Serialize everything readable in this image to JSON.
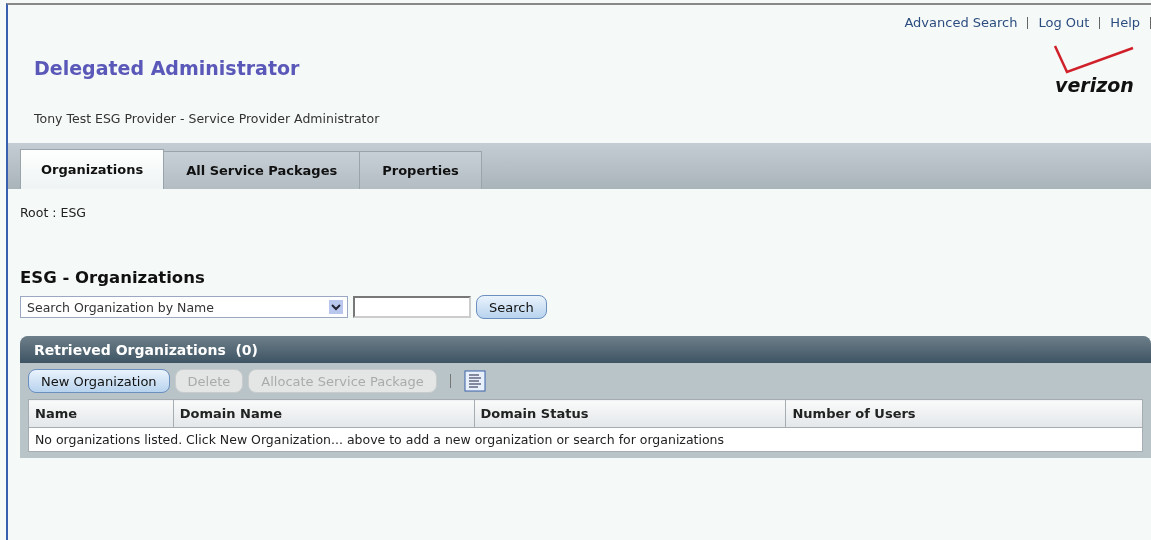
{
  "header": {
    "links": [
      "Advanced Search",
      "Log Out",
      "Help"
    ],
    "app_title": "Delegated Administrator",
    "subtitle": "Tony Test ESG Provider - Service Provider Administrator",
    "logo_text": "verizon"
  },
  "tabs": [
    {
      "label": "Organizations",
      "selected": true
    },
    {
      "label": "All Service Packages",
      "selected": false
    },
    {
      "label": "Properties",
      "selected": false
    }
  ],
  "breadcrumb": "Root : ESG",
  "heading": "ESG - Organizations",
  "search": {
    "select_value": "Search Organization by Name",
    "button": "Search"
  },
  "panel": {
    "title": "Retrieved Organizations",
    "count": "(0)",
    "buttons": [
      {
        "label": "New Organization",
        "disabled": false
      },
      {
        "label": "Delete",
        "disabled": true
      },
      {
        "label": "Allocate Service Package",
        "disabled": true
      }
    ],
    "table": {
      "columns": [
        "Name",
        "Domain Name",
        "Domain Status",
        "Number of Users"
      ],
      "empty_message": "No organizations listed. Click New Organization... above to add a new organization or search for organizations"
    }
  }
}
